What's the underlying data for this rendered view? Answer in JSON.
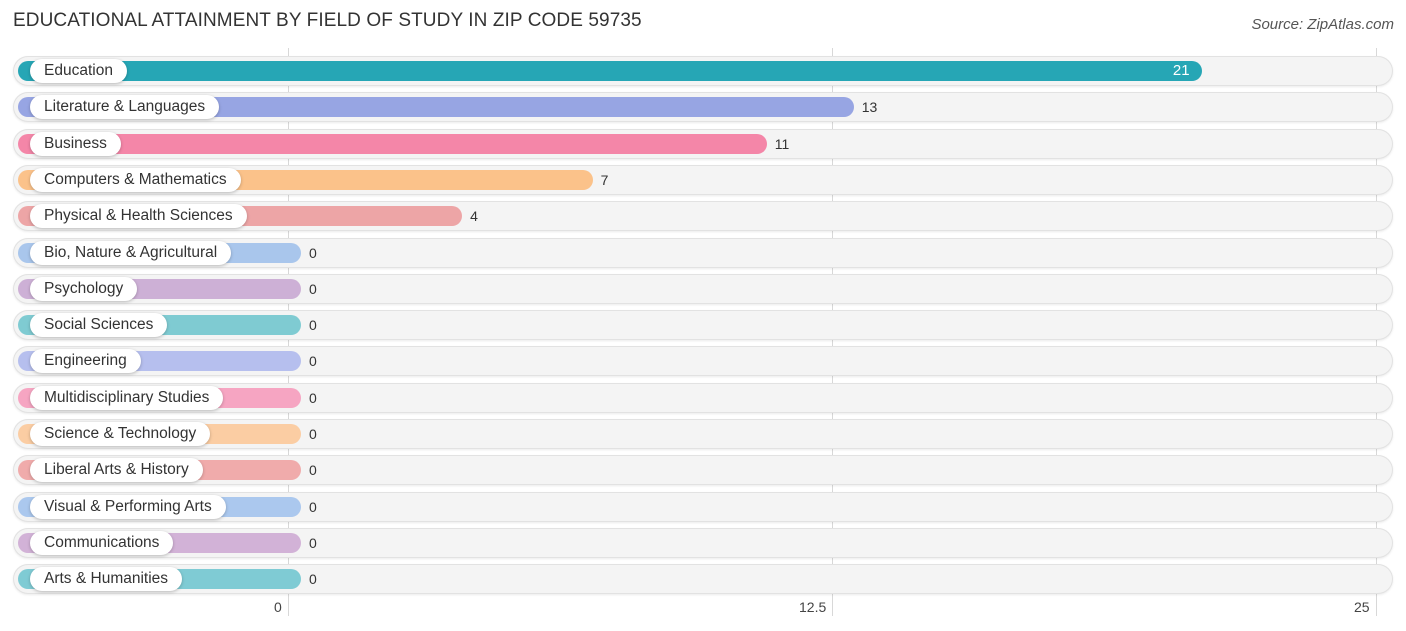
{
  "header": {
    "title": "EDUCATIONAL ATTAINMENT BY FIELD OF STUDY IN ZIP CODE 59735",
    "source": "Source: ZipAtlas.com"
  },
  "chart_data": {
    "type": "bar",
    "orientation": "horizontal",
    "title": "EDUCATIONAL ATTAINMENT BY FIELD OF STUDY IN ZIP CODE 59735",
    "xlabel": "",
    "ylabel": "",
    "xlim": [
      0,
      25
    ],
    "x_ticks": [
      "0",
      "12.5",
      "25"
    ],
    "x_tick_values": [
      0,
      12.5,
      25
    ],
    "grid": true,
    "categories": [
      "Education",
      "Literature & Languages",
      "Business",
      "Computers & Mathematics",
      "Physical & Health Sciences",
      "Bio, Nature & Agricultural",
      "Psychology",
      "Social Sciences",
      "Engineering",
      "Multidisciplinary Studies",
      "Science & Technology",
      "Liberal Arts & History",
      "Visual & Performing Arts",
      "Communications",
      "Arts & Humanities"
    ],
    "values": [
      21,
      13,
      11,
      7,
      4,
      0,
      0,
      0,
      0,
      0,
      0,
      0,
      0,
      0,
      0
    ],
    "value_labels": [
      "21",
      "13",
      "11",
      "7",
      "4",
      "0",
      "0",
      "0",
      "0",
      "0",
      "0",
      "0",
      "0",
      "0",
      "0"
    ],
    "colors": [
      "#26a6b5",
      "#97a5e3",
      "#f486a8",
      "#fbc28a",
      "#eda5a6",
      "#a9c6ec",
      "#cdb0d6",
      "#7fcbd2",
      "#b6bfee",
      "#f6a5c2",
      "#fbcda3",
      "#f0abab",
      "#abc8ee",
      "#d2b2d7",
      "#7fcbd4"
    ]
  }
}
